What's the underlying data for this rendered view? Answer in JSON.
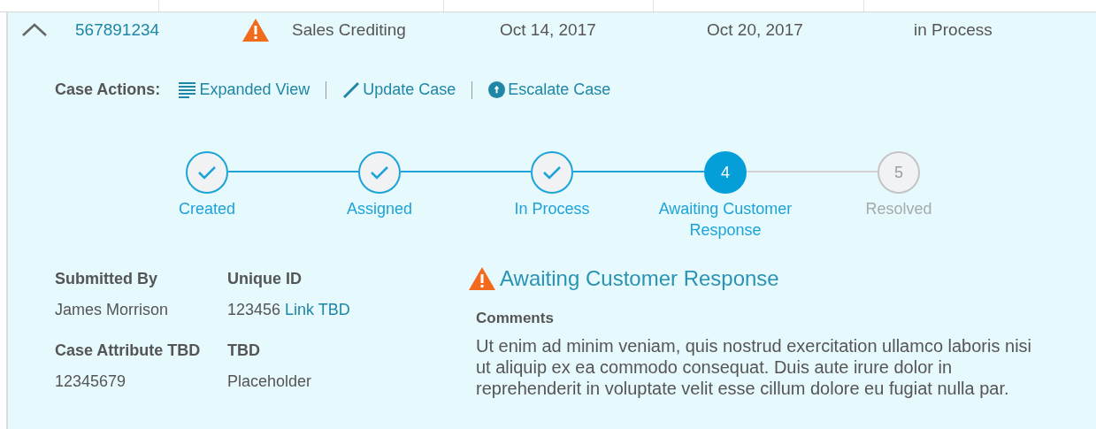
{
  "case_row": {
    "expanded": true,
    "case_id": "567891234",
    "warning": true,
    "type": "Sales Crediting",
    "opened": "Oct 14, 2017",
    "updated": "Oct 20, 2017",
    "status": "in Process"
  },
  "case_actions": {
    "label": "Case Actions:",
    "actions": [
      {
        "kind": "expand",
        "label": "Expanded View"
      },
      {
        "kind": "edit",
        "label": "Update Case"
      },
      {
        "kind": "escalate",
        "label": "Escalate Case"
      }
    ]
  },
  "steps": [
    {
      "label": "Created",
      "completed": true,
      "selected": false
    },
    {
      "label": "Assigned",
      "completed": true,
      "selected": false
    },
    {
      "label": "In Process",
      "completed": true,
      "selected": false
    },
    {
      "label": "Awaiting Customer Response",
      "completed": false,
      "selected": true,
      "number": "4"
    },
    {
      "label": "Resolved",
      "completed": false,
      "selected": false,
      "number": "5"
    }
  ],
  "details": [
    {
      "label": "Submitted By",
      "value": "James Morrison"
    },
    {
      "label": "Unique ID",
      "value": "123456",
      "link": "Link TBD"
    },
    {
      "label": "Case Attribute TBD",
      "value": "12345679"
    },
    {
      "label": "TBD",
      "value": "Placeholder"
    }
  ],
  "status_panel": {
    "title": "Awaiting Customer Response",
    "warning": true,
    "comments_label": "Comments",
    "comments": "Ut enim ad minim veniam, quis nostrud exercitation ullamco laboris nisi ut aliquip ex ea commodo consequat. Duis aute irure dolor in reprehenderit in voluptate velit esse cillum dolore eu fugiat nulla par."
  }
}
